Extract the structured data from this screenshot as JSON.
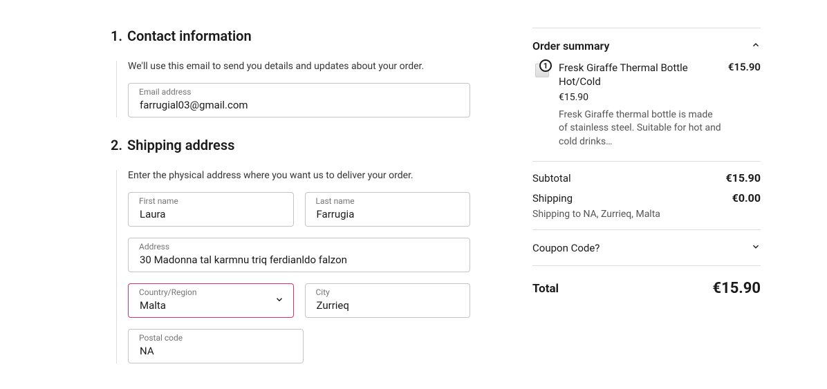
{
  "contact": {
    "step_num": "1.",
    "title": "Contact information",
    "desc": "We'll use this email to send you details and updates about your order.",
    "email_label": "Email address",
    "email_value": "farrugial03@gmail.com"
  },
  "shipping": {
    "step_num": "2.",
    "title": "Shipping address",
    "desc": "Enter the physical address where you want us to deliver your order.",
    "first_name_label": "First name",
    "first_name_value": "Laura",
    "last_name_label": "Last name",
    "last_name_value": "Farrugia",
    "address_label": "Address",
    "address_value": "30 Madonna tal karmnu triq ferdianldo falzon",
    "country_label": "Country/Region",
    "country_value": "Malta",
    "city_label": "City",
    "city_value": "Zurrieq",
    "postal_label": "Postal code",
    "postal_value": "NA"
  },
  "summary": {
    "title": "Order summary",
    "item": {
      "qty": "1",
      "name": "Fresk Giraffe Thermal Bottle Hot/Cold",
      "unit_price": "€15.90",
      "desc": "Fresk Giraffe thermal bottle is made of stainless steel. Suitable for hot and cold drinks…",
      "line_price": "€15.90"
    },
    "subtotal_label": "Subtotal",
    "subtotal_value": "€15.90",
    "shipping_label": "Shipping",
    "shipping_value": "€0.00",
    "shipping_dest": "Shipping to NA, Zurrieq, Malta",
    "coupon_label": "Coupon Code?",
    "total_label": "Total",
    "total_value": "€15.90"
  }
}
